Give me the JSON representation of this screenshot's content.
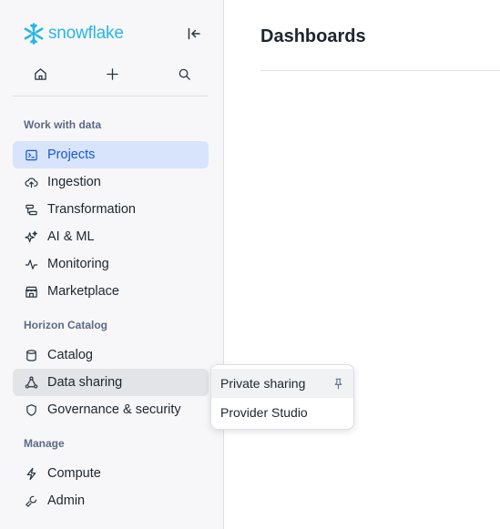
{
  "brand": {
    "name": "snowflake",
    "color": "#29b5e8"
  },
  "quick_actions": [
    {
      "name": "home-icon"
    },
    {
      "name": "plus-icon"
    },
    {
      "name": "search-icon"
    }
  ],
  "sections": {
    "work": "Work with data",
    "horizon": "Horizon Catalog",
    "manage": "Manage"
  },
  "nav": {
    "projects": "Projects",
    "ingestion": "Ingestion",
    "transformation": "Transformation",
    "ai_ml": "AI & ML",
    "monitoring": "Monitoring",
    "marketplace": "Marketplace",
    "catalog": "Catalog",
    "data_sharing": "Data sharing",
    "governance": "Governance & security",
    "compute": "Compute",
    "admin": "Admin"
  },
  "main": {
    "title": "Dashboards"
  },
  "popup": {
    "items": [
      "Private sharing",
      "Provider Studio"
    ]
  },
  "colors": {
    "active_bg": "#d7e4fb",
    "active_text": "#1a56db",
    "accent": "#29b5e8"
  }
}
